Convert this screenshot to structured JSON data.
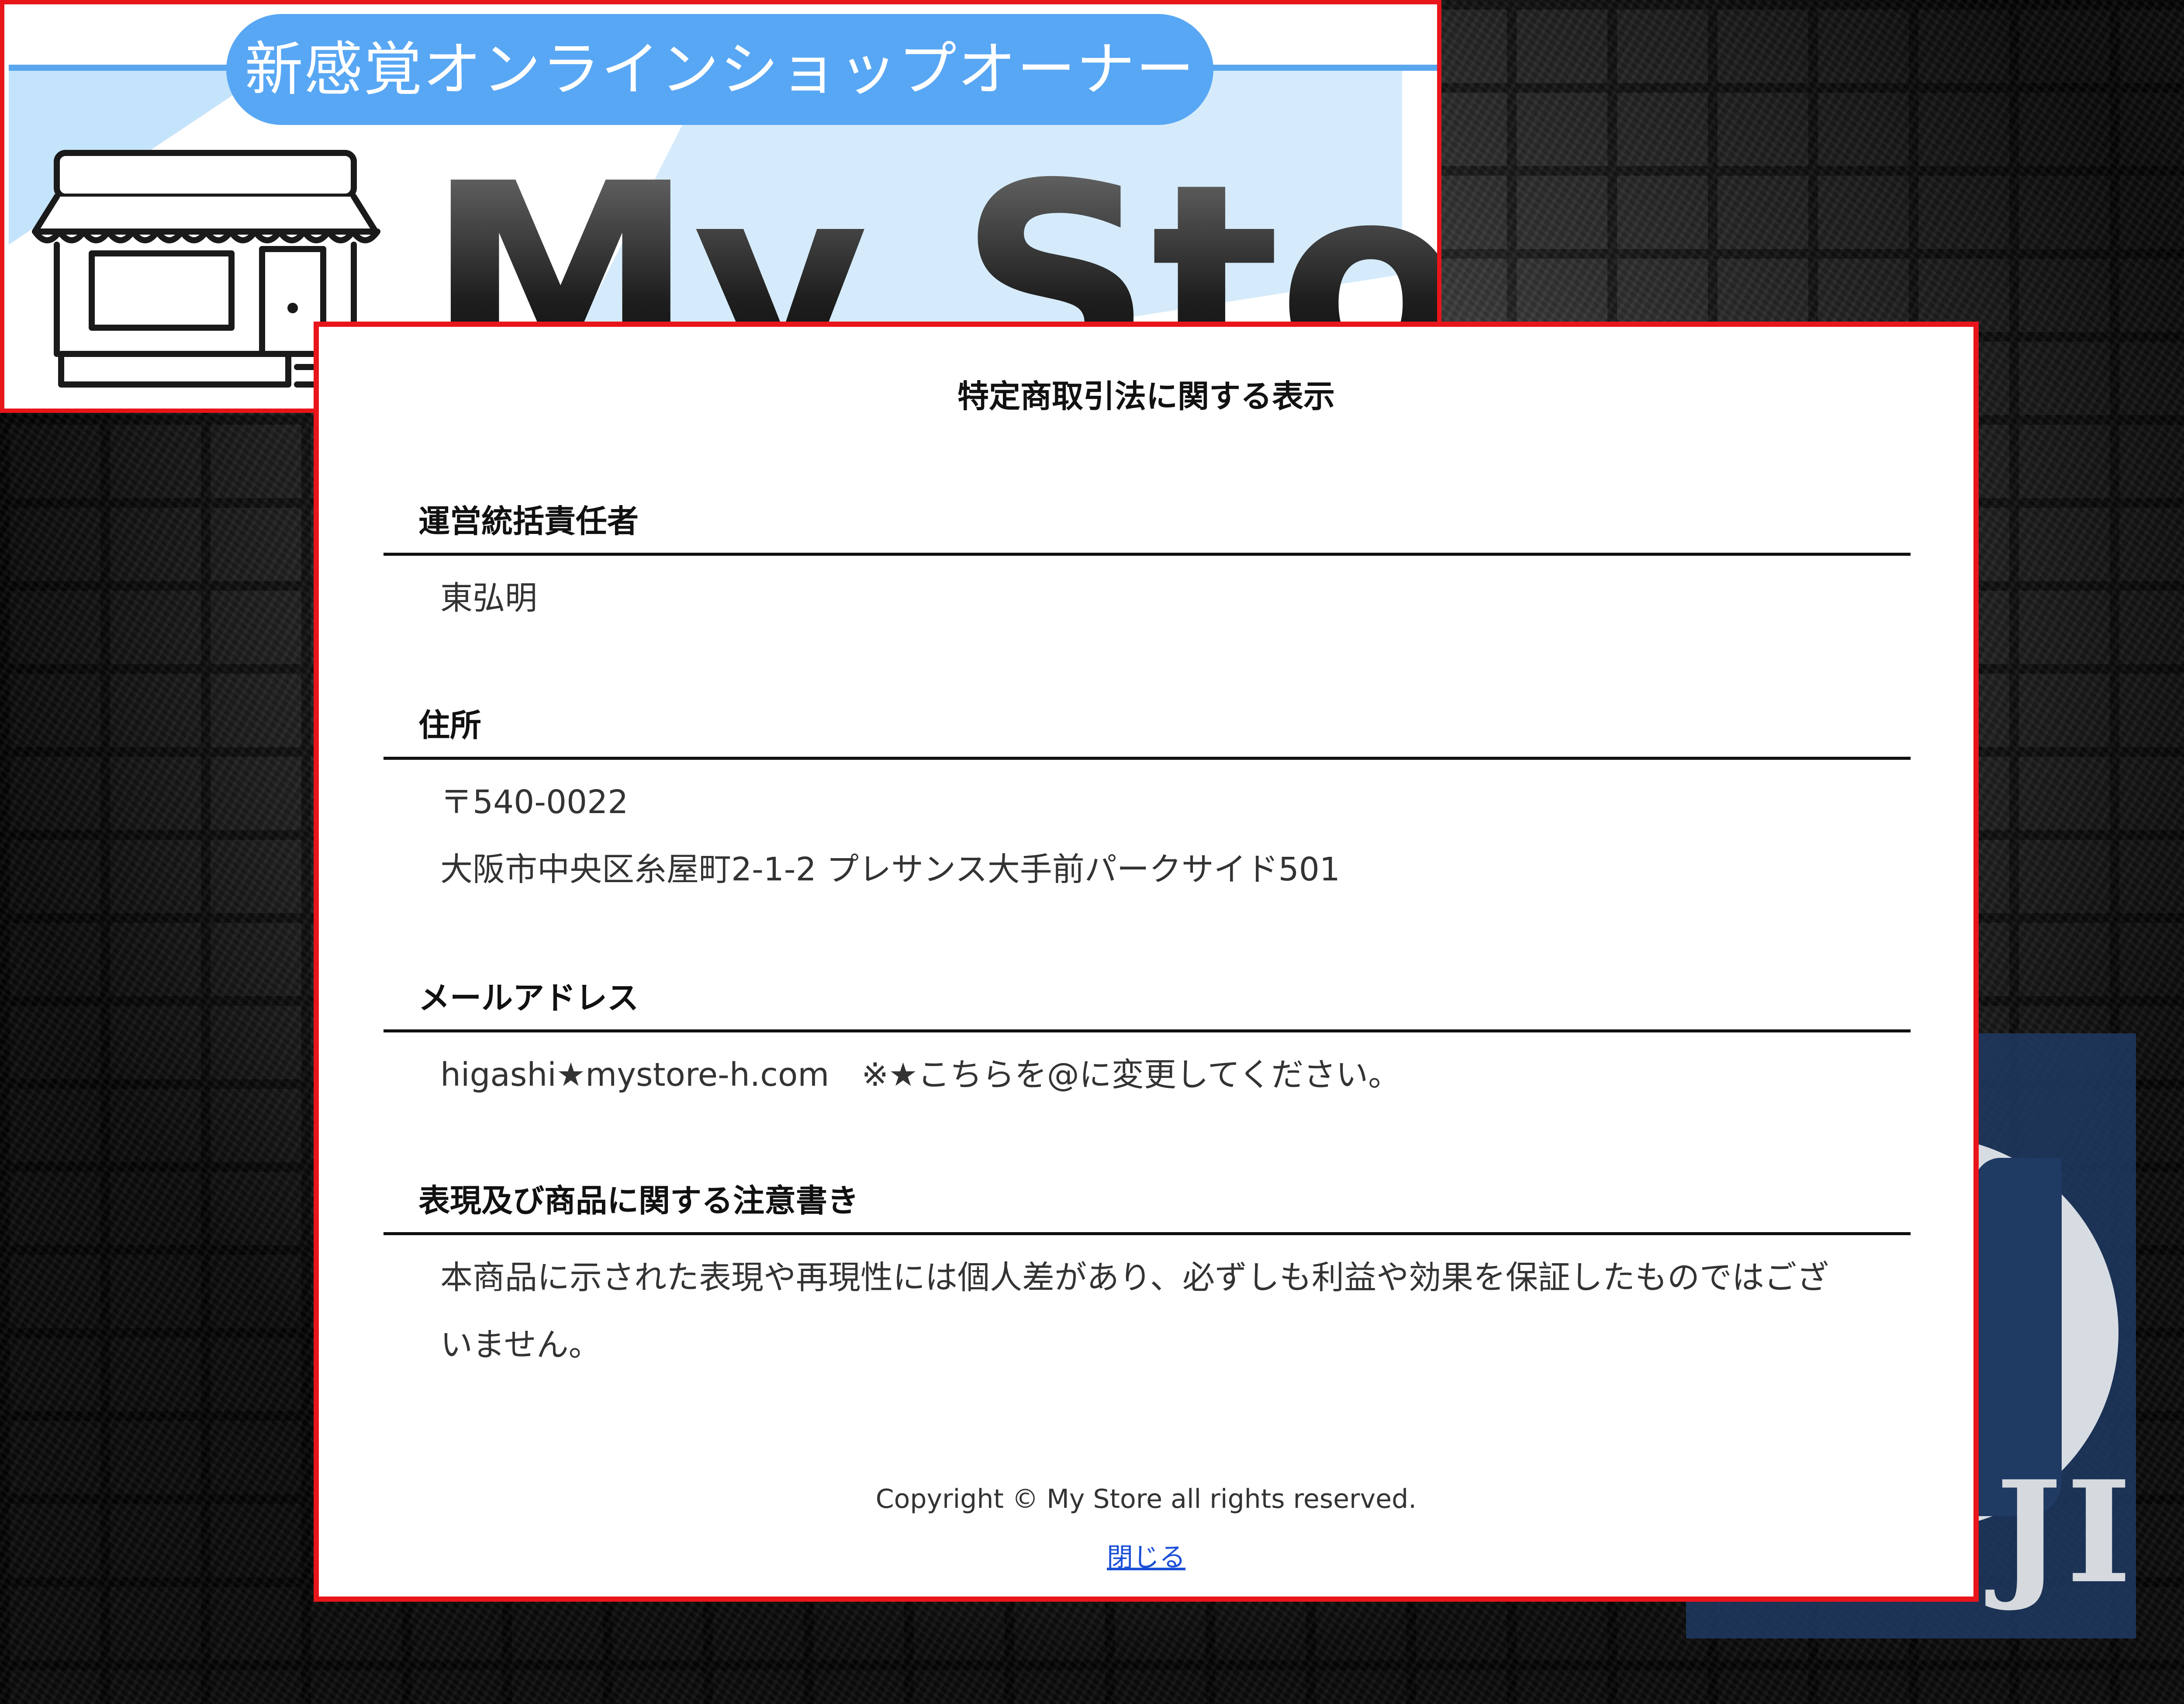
{
  "banner": {
    "tagline": "新感覚オンラインショップオーナー",
    "brand": "My Store"
  },
  "poster": {
    "text": "JI"
  },
  "modal": {
    "title": "特定商取引法に関する表示",
    "sections": [
      {
        "heading": "運営統括責任者",
        "lines": [
          "東弘明"
        ]
      },
      {
        "heading": "住所",
        "lines": [
          "〒540-0022",
          "大阪市中央区糸屋町2-1-2 プレサンス大手前パークサイド501"
        ]
      },
      {
        "heading": "メールアドレス",
        "lines": [
          "higashi★mystore-h.com　※★こちらを@に変更してください。"
        ]
      },
      {
        "heading": "表現及び商品に関する注意書き",
        "lines": [
          "本商品に示された表現や再現性には個人差があり、必ずしも利益や効果を保証したものではございません。"
        ]
      }
    ],
    "copyright": "Copyright © My Store all rights reserved.",
    "close_label": "閉じる"
  },
  "colors": {
    "frame_border": "#e8151b",
    "banner_blue": "#58a7f4",
    "link": "#1a4fd6"
  }
}
